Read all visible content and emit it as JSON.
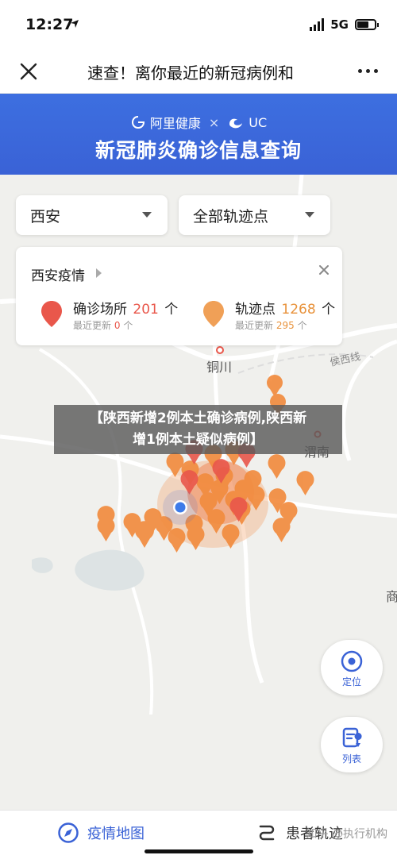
{
  "status_bar": {
    "time": "12:27",
    "network": "5G"
  },
  "nav": {
    "title": "速查！离你最近的新冠病例和"
  },
  "banner": {
    "brand_alihealth": "阿里健康",
    "separator": "×",
    "brand_uc": "UC",
    "title": "新冠肺炎确诊信息查询"
  },
  "filters": {
    "city": "西安",
    "category": "全部轨迹点"
  },
  "card": {
    "title": "西安疫情",
    "confirmed": {
      "label": "确诊场所",
      "count": "201",
      "unit": "个",
      "sub_label": "最近更新",
      "sub_count": "0",
      "sub_unit": "个"
    },
    "tracks": {
      "label": "轨迹点",
      "count": "1268",
      "unit": "个",
      "sub_label": "最近更新",
      "sub_count": "295",
      "sub_unit": "个"
    }
  },
  "map": {
    "label_tongchuan": "铜川",
    "label_weinan": "渭南",
    "label_railway": "侯西线",
    "label_shang": "商"
  },
  "headline": {
    "line1": "【陕西新增2例本土确诊病例,陕西新",
    "line2": "增1例本土疑似病例】"
  },
  "buttons": {
    "locate": "定位",
    "list": "列表"
  },
  "watermark": "知乎 @执行机构",
  "tabs": {
    "map": "疫情地图",
    "track": "患者轨迹"
  },
  "colors": {
    "primary": "#3a62d6",
    "confirmed": "#e9574b",
    "track": "#e8923b"
  }
}
